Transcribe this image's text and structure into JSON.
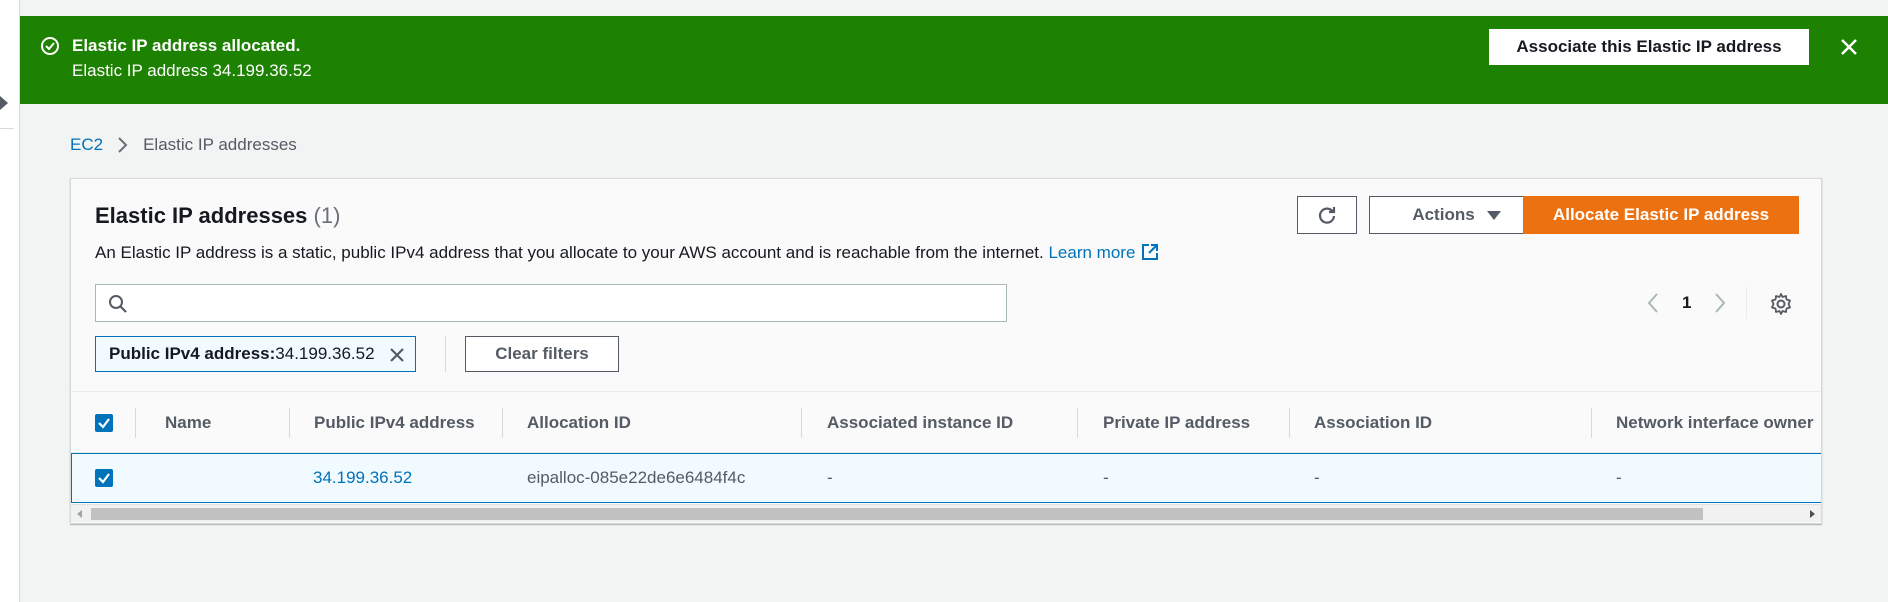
{
  "flash": {
    "title": "Elastic IP address allocated.",
    "message": "Elastic IP address 34.199.36.52",
    "associate_button": "Associate this Elastic IP address",
    "color": "#1d8102"
  },
  "breadcrumb": {
    "root": "EC2",
    "current": "Elastic IP addresses"
  },
  "panel": {
    "title": "Elastic IP addresses",
    "count": "(1)",
    "description": "An Elastic IP address is a static, public IPv4 address that you allocate to your AWS account and is reachable from the internet.",
    "learn_more": "Learn more",
    "actions_button": "Actions",
    "allocate_button": "Allocate Elastic IP address",
    "accent": "#ec7211"
  },
  "search": {
    "placeholder": "",
    "value": ""
  },
  "pagination": {
    "current_page": "1"
  },
  "filter": {
    "token_key": "Public IPv4 address:",
    "token_value": " 34.199.36.52",
    "clear_button": "Clear filters"
  },
  "table": {
    "columns": [
      "Name",
      "Public IPv4 address",
      "Allocation ID",
      "Associated instance ID",
      "Private IP address",
      "Association ID",
      "Network interface owner"
    ],
    "rows": [
      {
        "selected": true,
        "name": "",
        "public_ip": "34.199.36.52",
        "allocation_id": "eipalloc-085e22de6e6484f4c",
        "instance_id": "-",
        "private_ip": "-",
        "association_id": "-",
        "ni_owner": "-"
      }
    ]
  },
  "icons": {
    "flash": "check-circle-icon",
    "close": "close-icon",
    "refresh": "refresh-icon",
    "search": "search-icon",
    "settings": "gear-icon",
    "external": "external-link-icon"
  }
}
